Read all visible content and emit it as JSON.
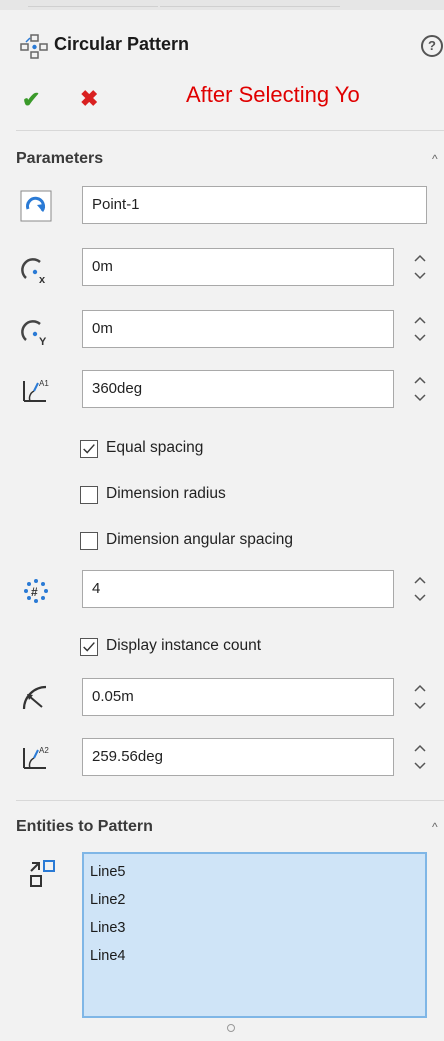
{
  "header": {
    "title": "Circular Pattern",
    "help_glyph": "?",
    "ok_glyph": "✔",
    "cancel_glyph": "✖",
    "annotation": "After Selecting Yo",
    "annotation_color": "#e00000"
  },
  "parameters": {
    "section_title": "Parameters",
    "center": "Point-1",
    "center_x": "0m",
    "center_y": "0m",
    "total_angle": "360deg",
    "equal_spacing": {
      "label": "Equal spacing",
      "checked": true
    },
    "dimension_radius": {
      "label": "Dimension radius",
      "checked": false
    },
    "dimension_angular_spacing": {
      "label": "Dimension angular spacing",
      "checked": false
    },
    "instance_count": "4",
    "display_instance_count": {
      "label": "Display instance count",
      "checked": true
    },
    "radius": "0.05m",
    "angle": "259.56deg"
  },
  "entities": {
    "section_title": "Entities to Pattern",
    "items": [
      "Line5",
      "Line2",
      "Line3",
      "Line4"
    ],
    "list_bg": "#cfe4f7"
  },
  "icons": {
    "title": "circular-pattern-icon",
    "center": "rotate-arrow-icon",
    "center_x": "center-x-icon",
    "center_y": "center-y-icon",
    "angle": "angle-icon",
    "count": "instance-count-icon",
    "radius": "radius-icon",
    "entities": "entities-icon"
  }
}
